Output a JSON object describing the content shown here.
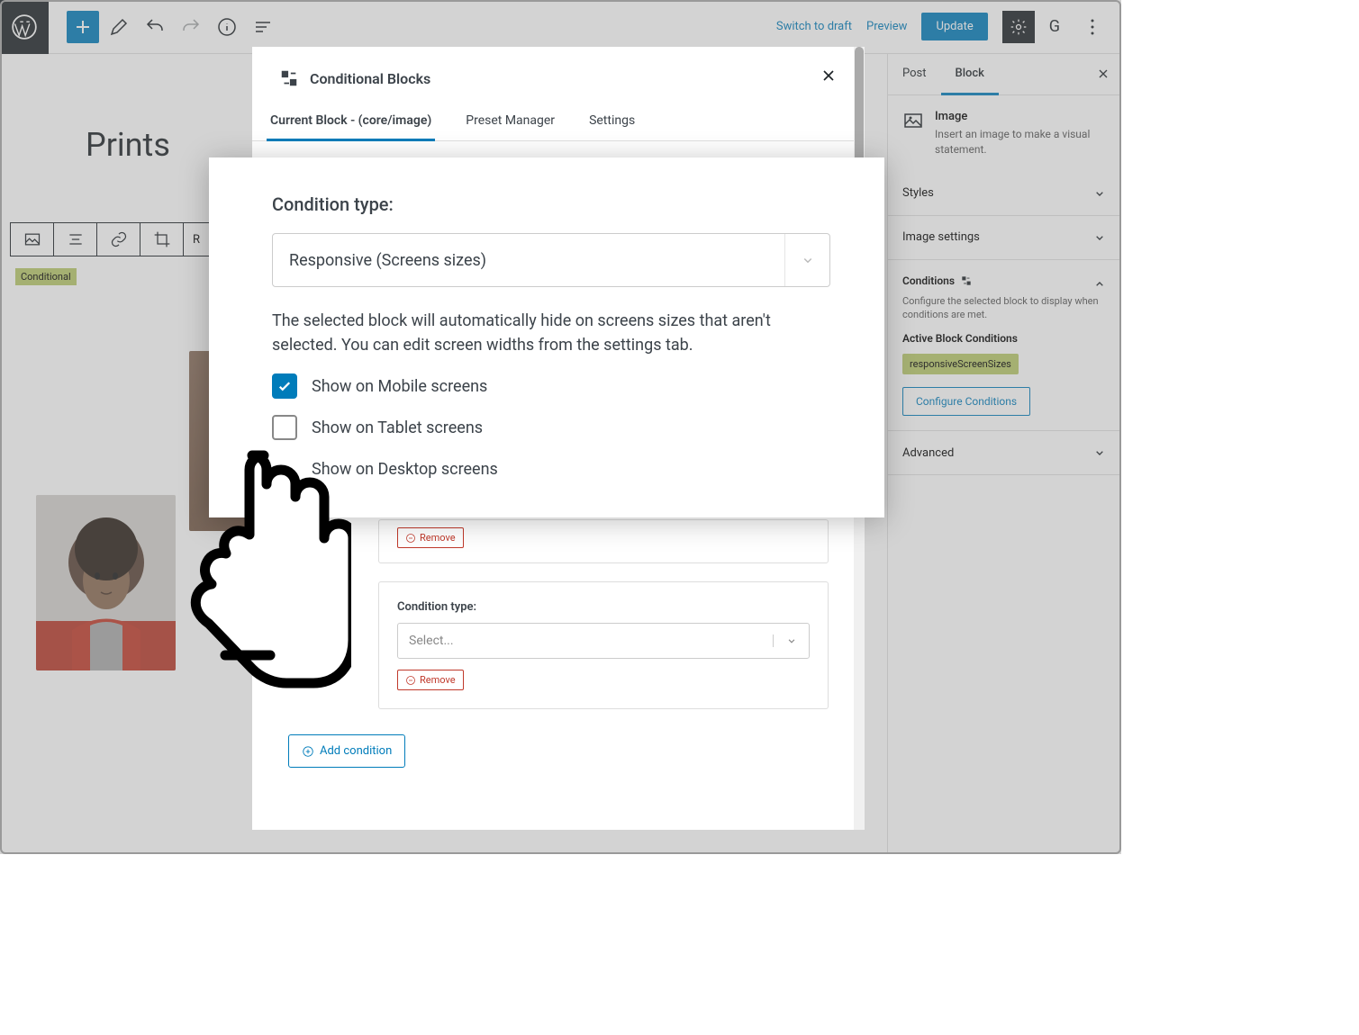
{
  "topbar": {
    "switch_draft": "Switch to draft",
    "preview": "Preview",
    "update": "Update",
    "g_letter": "G"
  },
  "page": {
    "title": "Prints",
    "conditional_badge": "Conditional",
    "toolbar_last": "R"
  },
  "sidebar": {
    "tabs": {
      "post": "Post",
      "block": "Block"
    },
    "block_desc": {
      "title": "Image",
      "text": "Insert an image to make a visual statement."
    },
    "sections": {
      "styles": "Styles",
      "image_settings": "Image settings",
      "advanced": "Advanced"
    },
    "conditions": {
      "title": "Conditions",
      "desc": "Configure the selected block to display when conditions are met.",
      "active_label": "Active Block Conditions",
      "pill": "responsiveScreenSizes",
      "configure_btn": "Configure Conditions"
    }
  },
  "modal": {
    "title": "Conditional Blocks",
    "tabs": {
      "current": "Current Block - (core/image)",
      "preset": "Preset Manager",
      "settings": "Settings"
    },
    "behind": {
      "cond_type_label": "Condition type:",
      "select_placeholder": "Select...",
      "remove": "Remove",
      "add_condition": "Add condition"
    }
  },
  "front": {
    "label": "Condition type:",
    "selected": "Responsive (Screens sizes)",
    "desc": "The selected block will automatically hide on screens sizes that aren't selected. You can edit screen widths from the settings tab.",
    "cb_mobile": "Show on Mobile screens",
    "cb_tablet": "Show on Tablet screens",
    "cb_desktop": "Show on Desktop screens"
  }
}
